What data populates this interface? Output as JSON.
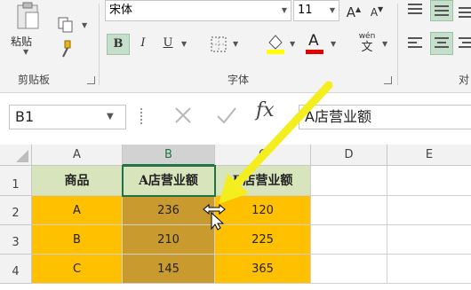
{
  "ribbon": {
    "clipboard": {
      "paste_label": "粘贴",
      "group_label": "剪贴板"
    },
    "font": {
      "font_name": "宋体",
      "font_size": "11",
      "bold": "B",
      "italic": "I",
      "underline": "U",
      "font_color_letter": "A",
      "pinyin_top": "wén",
      "pinyin_bottom": "文",
      "grow": "A",
      "shrink": "A",
      "group_label": "字体"
    },
    "alignment": {
      "group_label": "对"
    }
  },
  "formula_bar": {
    "name_box": "B1",
    "fx": "fx",
    "content": "A店营业额"
  },
  "sheet": {
    "columns": [
      "A",
      "B",
      "C",
      "D",
      "E"
    ],
    "rows": [
      "1",
      "2",
      "3",
      "4"
    ],
    "cells": [
      [
        "商品",
        "A店营业额",
        "B店营业额"
      ],
      [
        "A",
        "236",
        "120"
      ],
      [
        "B",
        "210",
        "225"
      ],
      [
        "C",
        "145",
        "365"
      ]
    ]
  },
  "colors": {
    "header_fill": "#d7e4bc",
    "data_fill": "#ffc000",
    "selected_fill": "#c99a2e",
    "accent_green": "#217346",
    "arrow": "#f5ee1e"
  }
}
